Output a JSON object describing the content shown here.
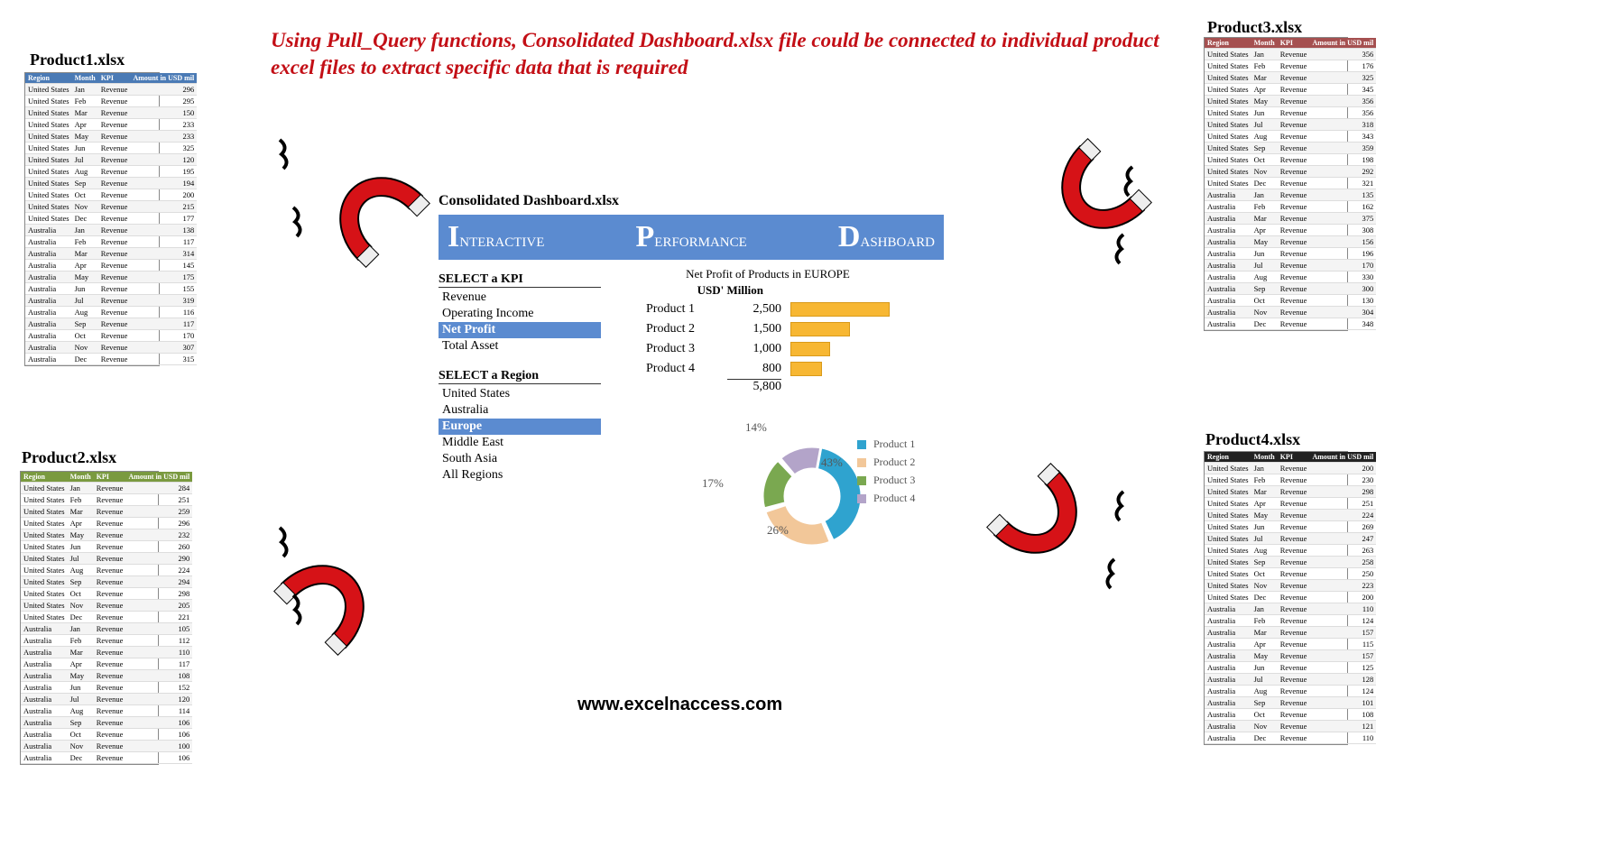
{
  "headline": "Using Pull_Query functions, Consolidated Dashboard.xlsx file could be connected to individual product excel files to extract specific data that is required",
  "site_url": "www.excelnaccess.com",
  "dashboard_filename": "Consolidated Dashboard.xlsx",
  "dashboard_banner": [
    "Interactive",
    "Performance",
    "Dashboard"
  ],
  "kpi_header": "SELECT a KPI",
  "kpi_list": [
    "Revenue",
    "Operating Income",
    "Net Profit",
    "Total Asset"
  ],
  "kpi_selected": "Net Profit",
  "region_header": "SELECT a Region",
  "region_list": [
    "United States",
    "Australia",
    "Europe",
    "Middle East",
    "South Asia",
    "All Regions"
  ],
  "region_selected": "Europe",
  "data_caption": "Net Profit of Products in EUROPE",
  "data_unit": "USD' Million",
  "chart_data": {
    "type": "bar",
    "categories": [
      "Product 1",
      "Product 2",
      "Product 3",
      "Product 4"
    ],
    "values": [
      2500,
      1500,
      1000,
      800
    ],
    "total": 5800,
    "title": "Net Profit of Products in EUROPE",
    "ylabel": "USD' Million"
  },
  "donut_data": {
    "type": "pie",
    "series": [
      {
        "name": "Product 1",
        "value": 43,
        "color": "#2fa3cf"
      },
      {
        "name": "Product 2",
        "value": 26,
        "color": "#f2c799"
      },
      {
        "name": "Product 3",
        "value": 17,
        "color": "#7aa850"
      },
      {
        "name": "Product 4",
        "value": 14,
        "color": "#b3a4c9"
      }
    ]
  },
  "files": {
    "product1": {
      "label": "Product1.xlsx",
      "header_color": "blue",
      "columns": [
        "Region",
        "Month",
        "KPI",
        "Amount in USD mil"
      ],
      "rows": [
        [
          "United States",
          "Jan",
          "Revenue",
          "296"
        ],
        [
          "United States",
          "Feb",
          "Revenue",
          "295"
        ],
        [
          "United States",
          "Mar",
          "Revenue",
          "150"
        ],
        [
          "United States",
          "Apr",
          "Revenue",
          "233"
        ],
        [
          "United States",
          "May",
          "Revenue",
          "233"
        ],
        [
          "United States",
          "Jun",
          "Revenue",
          "325"
        ],
        [
          "United States",
          "Jul",
          "Revenue",
          "120"
        ],
        [
          "United States",
          "Aug",
          "Revenue",
          "195"
        ],
        [
          "United States",
          "Sep",
          "Revenue",
          "194"
        ],
        [
          "United States",
          "Oct",
          "Revenue",
          "200"
        ],
        [
          "United States",
          "Nov",
          "Revenue",
          "215"
        ],
        [
          "United States",
          "Dec",
          "Revenue",
          "177"
        ],
        [
          "Australia",
          "Jan",
          "Revenue",
          "138"
        ],
        [
          "Australia",
          "Feb",
          "Revenue",
          "117"
        ],
        [
          "Australia",
          "Mar",
          "Revenue",
          "314"
        ],
        [
          "Australia",
          "Apr",
          "Revenue",
          "145"
        ],
        [
          "Australia",
          "May",
          "Revenue",
          "175"
        ],
        [
          "Australia",
          "Jun",
          "Revenue",
          "155"
        ],
        [
          "Australia",
          "Jul",
          "Revenue",
          "319"
        ],
        [
          "Australia",
          "Aug",
          "Revenue",
          "116"
        ],
        [
          "Australia",
          "Sep",
          "Revenue",
          "117"
        ],
        [
          "Australia",
          "Oct",
          "Revenue",
          "170"
        ],
        [
          "Australia",
          "Nov",
          "Revenue",
          "307"
        ],
        [
          "Australia",
          "Dec",
          "Revenue",
          "315"
        ]
      ]
    },
    "product2": {
      "label": "Product2.xlsx",
      "header_color": "green",
      "columns": [
        "Region",
        "Month",
        "KPI",
        "Amount in USD mil"
      ],
      "rows": [
        [
          "United States",
          "Jan",
          "Revenue",
          "284"
        ],
        [
          "United States",
          "Feb",
          "Revenue",
          "251"
        ],
        [
          "United States",
          "Mar",
          "Revenue",
          "259"
        ],
        [
          "United States",
          "Apr",
          "Revenue",
          "296"
        ],
        [
          "United States",
          "May",
          "Revenue",
          "232"
        ],
        [
          "United States",
          "Jun",
          "Revenue",
          "260"
        ],
        [
          "United States",
          "Jul",
          "Revenue",
          "290"
        ],
        [
          "United States",
          "Aug",
          "Revenue",
          "224"
        ],
        [
          "United States",
          "Sep",
          "Revenue",
          "294"
        ],
        [
          "United States",
          "Oct",
          "Revenue",
          "298"
        ],
        [
          "United States",
          "Nov",
          "Revenue",
          "205"
        ],
        [
          "United States",
          "Dec",
          "Revenue",
          "221"
        ],
        [
          "Australia",
          "Jan",
          "Revenue",
          "105"
        ],
        [
          "Australia",
          "Feb",
          "Revenue",
          "112"
        ],
        [
          "Australia",
          "Mar",
          "Revenue",
          "110"
        ],
        [
          "Australia",
          "Apr",
          "Revenue",
          "117"
        ],
        [
          "Australia",
          "May",
          "Revenue",
          "108"
        ],
        [
          "Australia",
          "Jun",
          "Revenue",
          "152"
        ],
        [
          "Australia",
          "Jul",
          "Revenue",
          "120"
        ],
        [
          "Australia",
          "Aug",
          "Revenue",
          "114"
        ],
        [
          "Australia",
          "Sep",
          "Revenue",
          "106"
        ],
        [
          "Australia",
          "Oct",
          "Revenue",
          "106"
        ],
        [
          "Australia",
          "Nov",
          "Revenue",
          "100"
        ],
        [
          "Australia",
          "Dec",
          "Revenue",
          "106"
        ]
      ]
    },
    "product3": {
      "label": "Product3.xlsx",
      "header_color": "red",
      "columns": [
        "Region",
        "Month",
        "KPI",
        "Amount in USD mil"
      ],
      "rows": [
        [
          "United States",
          "Jan",
          "Revenue",
          "356"
        ],
        [
          "United States",
          "Feb",
          "Revenue",
          "176"
        ],
        [
          "United States",
          "Mar",
          "Revenue",
          "325"
        ],
        [
          "United States",
          "Apr",
          "Revenue",
          "345"
        ],
        [
          "United States",
          "May",
          "Revenue",
          "356"
        ],
        [
          "United States",
          "Jun",
          "Revenue",
          "356"
        ],
        [
          "United States",
          "Jul",
          "Revenue",
          "318"
        ],
        [
          "United States",
          "Aug",
          "Revenue",
          "343"
        ],
        [
          "United States",
          "Sep",
          "Revenue",
          "359"
        ],
        [
          "United States",
          "Oct",
          "Revenue",
          "198"
        ],
        [
          "United States",
          "Nov",
          "Revenue",
          "292"
        ],
        [
          "United States",
          "Dec",
          "Revenue",
          "321"
        ],
        [
          "Australia",
          "Jan",
          "Revenue",
          "135"
        ],
        [
          "Australia",
          "Feb",
          "Revenue",
          "162"
        ],
        [
          "Australia",
          "Mar",
          "Revenue",
          "375"
        ],
        [
          "Australia",
          "Apr",
          "Revenue",
          "308"
        ],
        [
          "Australia",
          "May",
          "Revenue",
          "156"
        ],
        [
          "Australia",
          "Jun",
          "Revenue",
          "196"
        ],
        [
          "Australia",
          "Jul",
          "Revenue",
          "170"
        ],
        [
          "Australia",
          "Aug",
          "Revenue",
          "330"
        ],
        [
          "Australia",
          "Sep",
          "Revenue",
          "300"
        ],
        [
          "Australia",
          "Oct",
          "Revenue",
          "130"
        ],
        [
          "Australia",
          "Nov",
          "Revenue",
          "304"
        ],
        [
          "Australia",
          "Dec",
          "Revenue",
          "348"
        ]
      ]
    },
    "product4": {
      "label": "Product4.xlsx",
      "header_color": "black",
      "columns": [
        "Region",
        "Month",
        "KPI",
        "Amount in USD mil"
      ],
      "rows": [
        [
          "United States",
          "Jan",
          "Revenue",
          "200"
        ],
        [
          "United States",
          "Feb",
          "Revenue",
          "230"
        ],
        [
          "United States",
          "Mar",
          "Revenue",
          "298"
        ],
        [
          "United States",
          "Apr",
          "Revenue",
          "251"
        ],
        [
          "United States",
          "May",
          "Revenue",
          "224"
        ],
        [
          "United States",
          "Jun",
          "Revenue",
          "269"
        ],
        [
          "United States",
          "Jul",
          "Revenue",
          "247"
        ],
        [
          "United States",
          "Aug",
          "Revenue",
          "263"
        ],
        [
          "United States",
          "Sep",
          "Revenue",
          "258"
        ],
        [
          "United States",
          "Oct",
          "Revenue",
          "250"
        ],
        [
          "United States",
          "Nov",
          "Revenue",
          "223"
        ],
        [
          "United States",
          "Dec",
          "Revenue",
          "200"
        ],
        [
          "Australia",
          "Jan",
          "Revenue",
          "110"
        ],
        [
          "Australia",
          "Feb",
          "Revenue",
          "124"
        ],
        [
          "Australia",
          "Mar",
          "Revenue",
          "157"
        ],
        [
          "Australia",
          "Apr",
          "Revenue",
          "115"
        ],
        [
          "Australia",
          "May",
          "Revenue",
          "157"
        ],
        [
          "Australia",
          "Jun",
          "Revenue",
          "125"
        ],
        [
          "Australia",
          "Jul",
          "Revenue",
          "128"
        ],
        [
          "Australia",
          "Aug",
          "Revenue",
          "124"
        ],
        [
          "Australia",
          "Sep",
          "Revenue",
          "101"
        ],
        [
          "Australia",
          "Oct",
          "Revenue",
          "108"
        ],
        [
          "Australia",
          "Nov",
          "Revenue",
          "121"
        ],
        [
          "Australia",
          "Dec",
          "Revenue",
          "110"
        ]
      ]
    }
  }
}
